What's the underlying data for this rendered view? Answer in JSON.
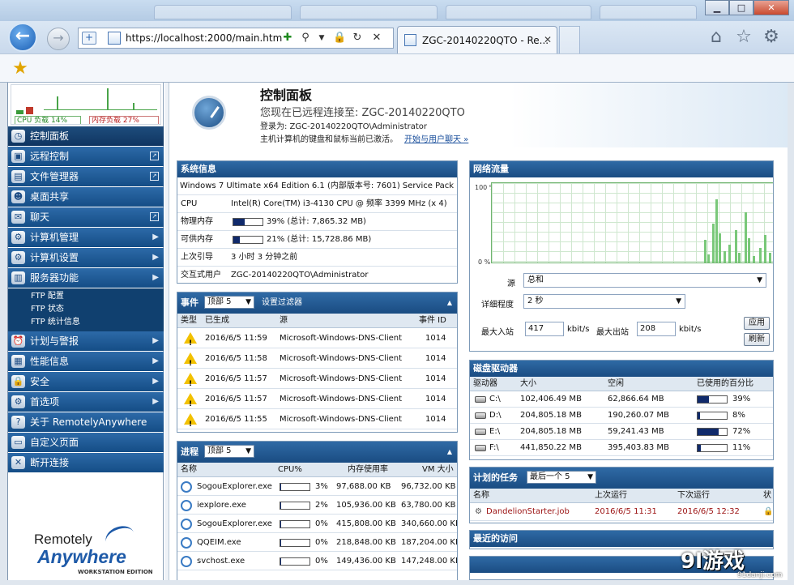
{
  "browser": {
    "url": "https://localhost:2000/main.htm",
    "tab_title": "ZGC-20140220QTO - Re...",
    "back_glyph": "←",
    "forward_glyph": "→",
    "close_glyph": "✕",
    "win_min": "▁",
    "win_max": "□",
    "win_close": "✕"
  },
  "sidebar": {
    "cpu_load": "CPU 负载 14%",
    "mem_load": "内存负载 27%",
    "items": [
      {
        "label": "控制面板",
        "icon": "gauge-icon",
        "glyph": "◷",
        "active": true,
        "right": ""
      },
      {
        "label": "远程控制",
        "icon": "remote-control-icon",
        "glyph": "▣",
        "right": "ext"
      },
      {
        "label": "文件管理器",
        "icon": "file-manager-icon",
        "glyph": "▤",
        "right": "ext"
      },
      {
        "label": "桌面共享",
        "icon": "desktop-share-icon",
        "glyph": "☻",
        "right": ""
      },
      {
        "label": "聊天",
        "icon": "chat-icon",
        "glyph": "✉",
        "right": "ext"
      },
      {
        "label": "计算机管理",
        "icon": "computer-manage-icon",
        "glyph": "⚙",
        "right": "arrow"
      },
      {
        "label": "计算机设置",
        "icon": "computer-settings-icon",
        "glyph": "⚙",
        "right": "arrow"
      },
      {
        "label": "服务器功能",
        "icon": "server-icon",
        "glyph": "▥",
        "right": "arrow"
      }
    ],
    "submenu": [
      "FTP 配置",
      "FTP 状态",
      "FTP 统计信息"
    ],
    "items2": [
      {
        "label": "计划与警报",
        "icon": "schedule-icon",
        "glyph": "⏰",
        "right": "arrow"
      },
      {
        "label": "性能信息",
        "icon": "performance-icon",
        "glyph": "▦",
        "right": "arrow"
      },
      {
        "label": "安全",
        "icon": "lock-icon",
        "glyph": "🔒",
        "right": "arrow"
      },
      {
        "label": "首选项",
        "icon": "preferences-icon",
        "glyph": "⚙",
        "right": "arrow"
      },
      {
        "label": "关于 RemotelyAnywhere",
        "icon": "about-icon",
        "glyph": "?",
        "right": ""
      },
      {
        "label": "自定义页面",
        "icon": "custom-page-icon",
        "glyph": "▭",
        "right": ""
      },
      {
        "label": "断开连接",
        "icon": "disconnect-icon",
        "glyph": "✕",
        "right": ""
      }
    ],
    "logo": {
      "line1": "Remotely",
      "line2": "Anywhere",
      "line3": "WORKSTATION EDITION"
    }
  },
  "header": {
    "title": "控制面板",
    "subtitle": "您现在已远程连接至: ZGC-20140220QTO",
    "login": "登录为:   ZGC-20140220QTO\\Administrator",
    "note": "主机计算机的键盘和鼠标当前已激活。",
    "note_link": "开始与用户聊天 »"
  },
  "sysinfo": {
    "title": "系统信息",
    "os": "Windows 7 Ultimate x64 Edition 6.1 (内部版本号: 7601) Service Pack 1",
    "rows": [
      {
        "k": "CPU",
        "v": "Intel(R) Core(TM) i3-4130 CPU @ 频率  3399 MHz (x 4)"
      },
      {
        "k": "物理内存",
        "v": "39% (总计: 7,865.32 MB)",
        "pct": 39
      },
      {
        "k": "可供内存",
        "v": "21% (总计: 15,728.86 MB)",
        "pct": 21
      },
      {
        "k": "上次引导",
        "v": "3 小时  3 分钟之前"
      },
      {
        "k": "交互式用户",
        "v": "ZGC-20140220QTO\\Administrator"
      }
    ]
  },
  "events": {
    "title": "事件",
    "filter_select": "顶部 5",
    "filter_link": "设置过滤器",
    "cols": [
      "类型",
      "已生成",
      "源",
      "事件 ID"
    ],
    "rows": [
      {
        "time": "2016/6/5 11:59",
        "source": "Microsoft-Windows-DNS-Client",
        "id": "1014"
      },
      {
        "time": "2016/6/5 11:58",
        "source": "Microsoft-Windows-DNS-Client",
        "id": "1014"
      },
      {
        "time": "2016/6/5 11:57",
        "source": "Microsoft-Windows-DNS-Client",
        "id": "1014"
      },
      {
        "time": "2016/6/5 11:57",
        "source": "Microsoft-Windows-DNS-Client",
        "id": "1014"
      },
      {
        "time": "2016/6/5 11:55",
        "source": "Microsoft-Windows-DNS-Client",
        "id": "1014"
      }
    ]
  },
  "processes": {
    "title": "进程",
    "filter_select": "顶部 5",
    "cols": [
      "名称",
      "CPU%",
      "内存使用率",
      "VM 大小"
    ],
    "rows": [
      {
        "name": "SogouExplorer.exe",
        "cpu": "3%",
        "cpu_pct": 3,
        "mem": "97,688.00 KB",
        "vm": "96,732.00 KB"
      },
      {
        "name": "iexplore.exe",
        "cpu": "2%",
        "cpu_pct": 2,
        "mem": "105,936.00 KB",
        "vm": "63,780.00 KB"
      },
      {
        "name": "SogouExplorer.exe",
        "cpu": "0%",
        "cpu_pct": 0,
        "mem": "415,808.00 KB",
        "vm": "340,660.00 KB"
      },
      {
        "name": "QQEIM.exe",
        "cpu": "0%",
        "cpu_pct": 0,
        "mem": "218,848.00 KB",
        "vm": "187,204.00 KB"
      },
      {
        "name": "svchost.exe",
        "cpu": "0%",
        "cpu_pct": 0,
        "mem": "149,436.00 KB",
        "vm": "147,248.00 KB"
      }
    ]
  },
  "network": {
    "title": "网络流量",
    "y_top": "100 %",
    "y_bottom": "0 %",
    "source_label": "源",
    "source_value": "总和",
    "detail_label": "详细程度",
    "detail_value": "2 秒",
    "max_in_label": "最大入站",
    "max_in_value": "417",
    "max_out_label": "最大出站",
    "max_out_value": "208",
    "unit": "kbit/s",
    "apply": "应用",
    "refresh": "刷新"
  },
  "disks": {
    "title": "磁盘驱动器",
    "cols": [
      "驱动器",
      "大小",
      "空闲",
      "已使用的百分比"
    ],
    "rows": [
      {
        "drive": "C:\\",
        "size": "102,406.49 MB",
        "free": "62,866.64 MB",
        "pct": 39,
        "pct_text": "39%"
      },
      {
        "drive": "D:\\",
        "size": "204,805.18 MB",
        "free": "190,260.07 MB",
        "pct": 8,
        "pct_text": "8%"
      },
      {
        "drive": "E:\\",
        "size": "204,805.18 MB",
        "free": "59,241.43 MB",
        "pct": 72,
        "pct_text": "72%"
      },
      {
        "drive": "F:\\",
        "size": "441,850.22 MB",
        "free": "395,403.83 MB",
        "pct": 11,
        "pct_text": "11%"
      }
    ]
  },
  "scheduled": {
    "title": "计划的任务",
    "filter_select": "最后一个 5",
    "cols": [
      "名称",
      "上次运行",
      "下次运行",
      "状"
    ],
    "rows": [
      {
        "name": "DandelionStarter.job",
        "last": "2016/6/5 11:31",
        "next": "2016/6/5 12:32"
      }
    ]
  },
  "recent": {
    "title": "最近的访问"
  },
  "watermark": {
    "main": "9l游戏",
    "sub": "91danji.com"
  }
}
